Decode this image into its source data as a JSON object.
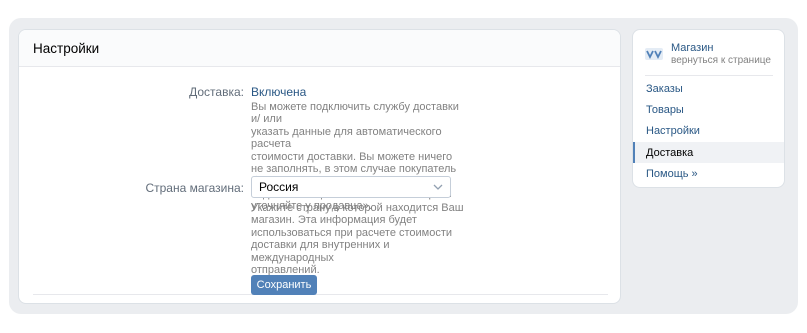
{
  "panel": {
    "title": "Настройки"
  },
  "delivery": {
    "label": "Доставка:",
    "status": "Включена",
    "description": "Вы можете подключить службу доставки и/ или\nуказать данные для автоматического расчета\nстоимости доставки. Вы можете ничего\nне заполнять, в этом случае покупатель будет\nвидеть сообщение «Стоимость и сроки\nуточняйте у продавца»."
  },
  "country": {
    "label": "Страна магазина:",
    "selected": "Россия",
    "description": "Укажите страну в которой находится Ваш\nмагазин. Эта информация будет\nиспользоваться при расчете стоимости\nдоставки для внутренних и международных\nотправлений."
  },
  "save_label": "Сохранить",
  "sidebar": {
    "shop_name": "Магазин",
    "back_link": "вернуться к странице",
    "items": [
      {
        "label": "Заказы"
      },
      {
        "label": "Товары"
      },
      {
        "label": "Настройки"
      },
      {
        "label": "Доставка"
      },
      {
        "label": "Помощь »"
      }
    ],
    "active_item": "Доставка"
  },
  "colors": {
    "accent": "#5181b8",
    "link": "#2a5885",
    "background": "#ebedf0"
  }
}
